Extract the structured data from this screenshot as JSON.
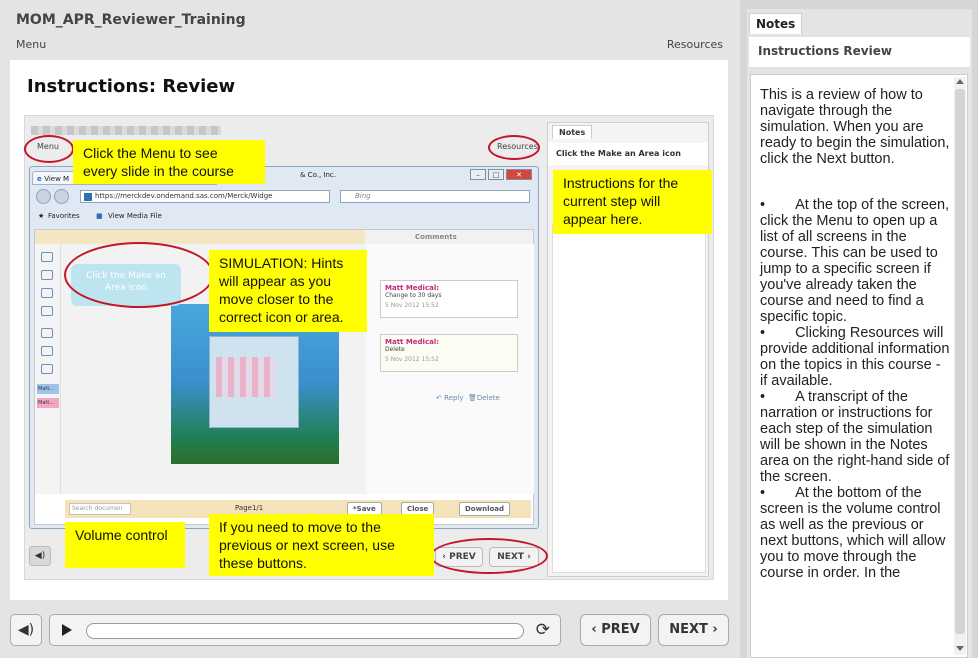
{
  "player": {
    "course_title": "MOM_APR_Reviewer_Training",
    "menu_label": "Menu",
    "resources_label": "Resources"
  },
  "slide": {
    "title": "Instructions: Review",
    "shot": {
      "menu_label": "Menu",
      "resources_label": "Resources",
      "notes_tab": "Notes",
      "notes_heading": "Click the Make an Area icon",
      "browser_tab": "View M",
      "browser_tab_company": "& Co., Inc.",
      "address_url": "https://merckdev.ondemand.sas.com/Merck/Widge",
      "bing_placeholder": "Bing",
      "favorites_label": "Favorites",
      "view_media_label": "View Media File",
      "comments_label": "Comments",
      "hint_bubble": "Click the Make an Area icon",
      "comments": [
        {
          "author": "Matt Medical:",
          "text": "Change to 30 days",
          "date": "5 Nov 2012 15:52"
        },
        {
          "author": "Matt Medical:",
          "text": "Delete",
          "date": "5 Nov 2012 15:52"
        }
      ],
      "reply_label": "Reply",
      "delete_label": "Delete",
      "tool_tag_1": "Matt...",
      "tool_tag_2": "Matt...",
      "search_placeholder": "Search documen",
      "page_label": "Page1/1",
      "save_label": "*Save",
      "close_label": "Close",
      "download_label": "Download",
      "prev_label": "‹ PREV",
      "next_label": "NEXT ›"
    },
    "callouts": {
      "menu": "Click the Menu to see every slide in the course",
      "instructions": "Instructions for the current step will appear here.",
      "simulation": "SIMULATION: Hints will appear as you move closer to the correct icon or area.",
      "volume": "Volume control",
      "navigation": "If you need to move to the previous or next screen, use these buttons."
    }
  },
  "controls": {
    "prev_label": "‹ PREV",
    "next_label": "NEXT ›"
  },
  "notes": {
    "tab_label": "Notes",
    "header": "Instructions Review",
    "intro": "This is a review of how to navigate through the simulation. When you are ready to begin the simulation, click the Next button.",
    "bullets": [
      "At the top of the screen, click the Menu to open up a list of all screens in the course. This can be used to jump to a specific screen if you've already taken the course and need to find a specific topic.",
      "Clicking Resources will provide additional information on the topics in this course - if available.",
      "A transcript of the narration or instructions for each step of the simulation will be shown in the Notes area on the right-hand side of the screen.",
      "At the bottom of the screen is the volume control as well as the previous or next buttons, which will allow you to move through the course in order. In the"
    ]
  }
}
